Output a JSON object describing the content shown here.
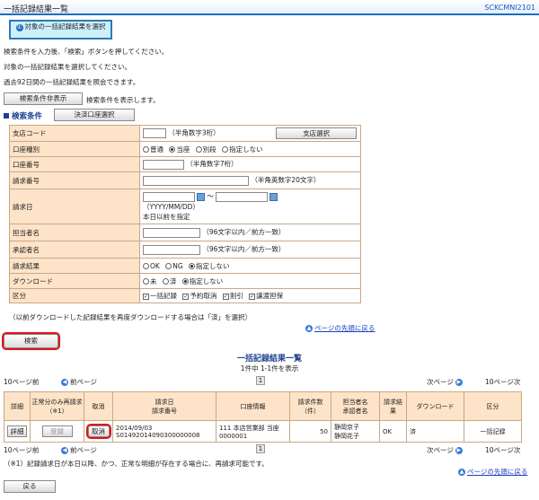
{
  "header": {
    "title": "一括記録結果一覧",
    "screen_code": "SCKCMNI2101"
  },
  "step": {
    "num": "①",
    "label": "対象の一括記録結果を選択"
  },
  "instructions": [
    "検索条件を入力後、「検索」ボタンを押してください。",
    "対象の一括記録結果を選択してください。",
    "過去92日間の一括記録結果を照会できます。"
  ],
  "toggle": {
    "button": "検索条件非表示",
    "note": "検索条件を表示します。"
  },
  "search": {
    "section_label": "検索条件",
    "account_select_button": "決済口座選択",
    "branch_code": {
      "label": "支店コード",
      "hint": "（半角数字3桁）",
      "button": "支店選択"
    },
    "account_type": {
      "label": "口座種別",
      "options": [
        "普通",
        "当座",
        "別段",
        "指定しない"
      ],
      "selected": "当座"
    },
    "account_number": {
      "label": "口座番号",
      "hint": "（半角数字7桁）"
    },
    "request_number": {
      "label": "請求番号",
      "hint": "（半角英数字20文字）"
    },
    "request_date": {
      "label": "請求日",
      "tilde": "～",
      "format": "（YYYY/MM/DD）",
      "note": "本日以前を指定"
    },
    "person": {
      "label": "担当者名",
      "hint": "（96文字以内／前方一致）"
    },
    "approver": {
      "label": "承認者名",
      "hint": "（96文字以内／前方一致）"
    },
    "result": {
      "label": "請求結果",
      "options": [
        "OK",
        "NG",
        "指定しない"
      ],
      "selected": "指定しない"
    },
    "download": {
      "label": "ダウンロード",
      "options": [
        "未",
        "済",
        "指定しない"
      ],
      "selected": "指定しない"
    },
    "category": {
      "label": "区分",
      "options": [
        "一括記録",
        "予約取消",
        "割引",
        "譲渡担保"
      ]
    },
    "footnote": "（以前ダウンロードした記録結果を再度ダウンロードする場合は「済」を選択）",
    "page_top_link": "ページの先頭に戻る",
    "search_button": "検索"
  },
  "results": {
    "title": "一括記録結果一覧",
    "count": "1件中 1-1件を表示",
    "pager": {
      "prev10": "10ページ前",
      "prev": "前ページ",
      "page": "1",
      "next": "次ページ",
      "next10": "10ページ次"
    },
    "columns": [
      "詳細",
      "正常分のみ再請求（※1）",
      "取消",
      "請求日\n請求番号",
      "口座情報",
      "請求件数（件）",
      "担当者名\n承認者名",
      "請求結果",
      "ダウンロード",
      "区分"
    ],
    "row": {
      "detail_button": "詳細",
      "rerequest_button": "登録",
      "cancel_button": "取消",
      "request_date": "2014/09/03",
      "request_number": "S01492014090300000008",
      "account_line1": "111 本店営業部 当座",
      "account_line2": "0000001",
      "count": "50",
      "person": "静岡京子",
      "approver": "静岡花子",
      "result": "OK",
      "download": "済",
      "category": "一括記録"
    },
    "footnote": "（※1）記録請求日が本日以降、かつ、正常な明細が存在する場合に、再請求可能です。",
    "page_top_link": "ページの先頭に戻る"
  },
  "back_button": "戻る"
}
